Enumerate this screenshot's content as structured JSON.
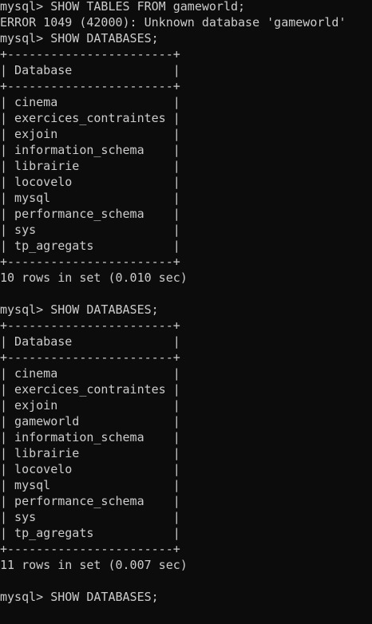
{
  "terminal": {
    "lines": [
      "mysql> SHOW TABLES FROM gameworld;",
      "ERROR 1049 (42000): Unknown database 'gameworld'",
      "mysql> SHOW DATABASES;",
      "+-----------------------+",
      "| Database              |",
      "+-----------------------+",
      "| cinema                |",
      "| exercices_contraintes |",
      "| exjoin                |",
      "| information_schema    |",
      "| librairie             |",
      "| locovelo              |",
      "| mysql                 |",
      "| performance_schema    |",
      "| sys                   |",
      "| tp_agregats           |",
      "+-----------------------+",
      "10 rows in set (0.010 sec)",
      "",
      "mysql> SHOW DATABASES;",
      "+-----------------------+",
      "| Database              |",
      "+-----------------------+",
      "| cinema                |",
      "| exercices_contraintes |",
      "| exjoin                |",
      "| gameworld             |",
      "| information_schema    |",
      "| librairie             |",
      "| locovelo              |",
      "| mysql                 |",
      "| performance_schema    |",
      "| sys                   |",
      "| tp_agregats           |",
      "+-----------------------+",
      "11 rows in set (0.007 sec)",
      "",
      "mysql> SHOW DATABASES;"
    ]
  }
}
